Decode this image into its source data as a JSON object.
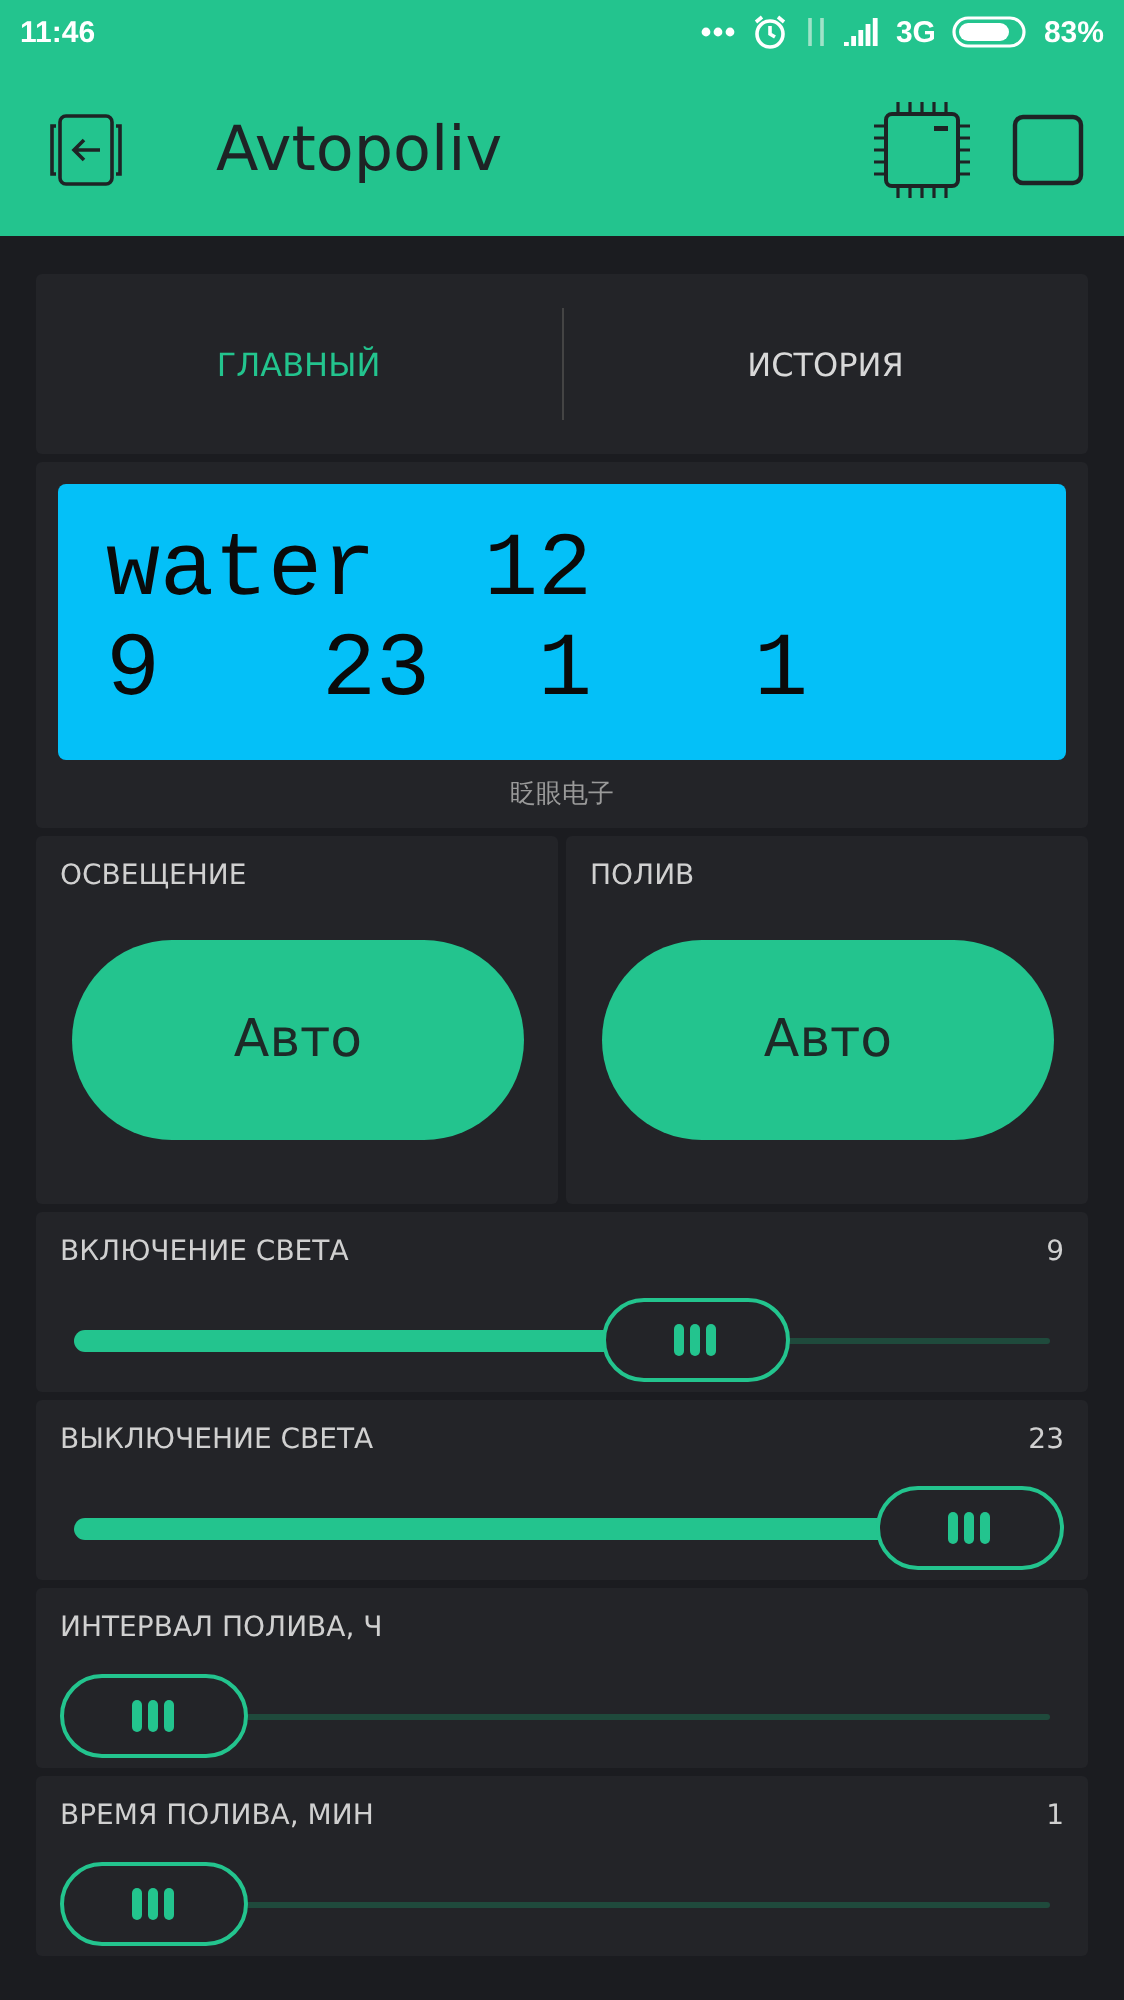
{
  "status_bar": {
    "time": "11:46",
    "network": "3G",
    "battery": "83%"
  },
  "app_bar": {
    "title": "Avtopoliv"
  },
  "tabs": [
    {
      "label": "ГЛАВНЫЙ",
      "selected": true
    },
    {
      "label": "ИСТОРИЯ",
      "selected": false
    }
  ],
  "lcd": {
    "lines": [
      "water  12",
      "9   23  1   1"
    ],
    "caption": "眨眼电子"
  },
  "buttons": [
    {
      "label": "ОСВЕЩЕНИЕ",
      "button": "Авто"
    },
    {
      "label": "ПОЛИВ",
      "button": "Авто"
    }
  ],
  "sliders": [
    {
      "label": "ВКЛЮЧЕНИЕ СВЕТА",
      "value": "9",
      "level": 0.665
    },
    {
      "label": "ВЫКЛЮЧЕНИЕ СВЕТА",
      "value": "23",
      "level": 1
    },
    {
      "label": "ИНТЕРВАЛ ПОЛИВА, Ч",
      "level": 0
    },
    {
      "label": "ВРЕМЯ ПОЛИВА, МИН",
      "value": "1",
      "level": 0
    }
  ]
}
